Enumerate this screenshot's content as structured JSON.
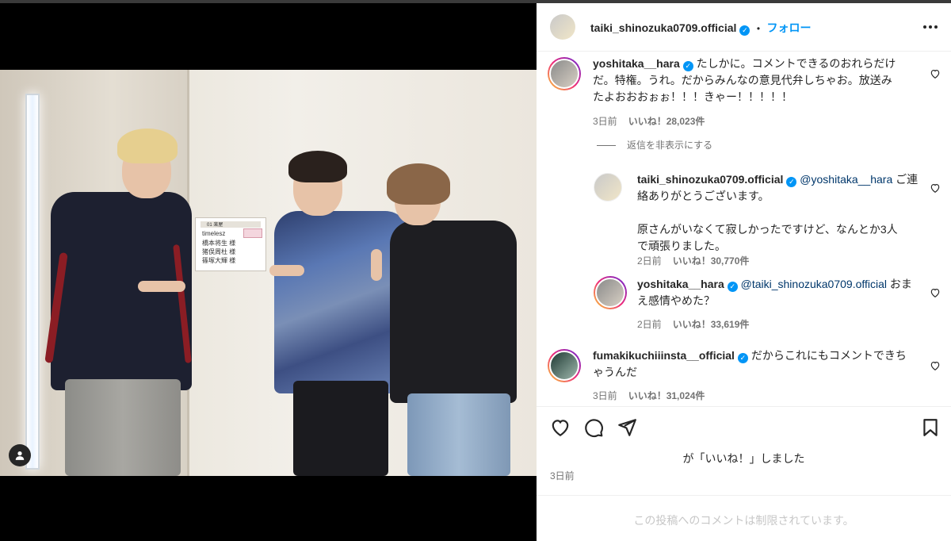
{
  "post": {
    "author": "taiki_shinozuka0709.official",
    "follow_label": "フォロー",
    "dot": "•",
    "more_icon": "more-horizontal-icon"
  },
  "photo": {
    "nameplate": {
      "header": "01 楽屋",
      "group": "timelesz",
      "names": [
        "橋本将生 様",
        "猪俣周杜 様",
        "篠塚大輝 様"
      ]
    }
  },
  "comments": [
    {
      "user": "yoshitaka__hara",
      "text_lines": [
        "たしかに。コメントできるのおれらだけ",
        "だ。特権。うれ。だからみんなの意見代弁しちゃお。放送み",
        "たよおおおぉぉ！！！きゃー！！！！！"
      ],
      "time": "3日前",
      "likes": "いいね！28,023件"
    }
  ],
  "hide_replies_label": "返信を非表示にする",
  "replies": [
    {
      "user": "taiki_shinozuka0709.official",
      "mention": "@yoshitaka__hara",
      "text_lines": [
        "ご連",
        "絡ありがとうございます。",
        "",
        "原さんがいなくて寂しかったですけど、なんとか3人",
        "で頑張りました。"
      ],
      "time": "2日前",
      "likes": "いいね！30,770件"
    },
    {
      "user": "yoshitaka__hara",
      "mention": "@taiki_shinozuka0709.official",
      "text_lines": [
        "おま",
        "え感情やめた？"
      ],
      "time": "2日前",
      "likes": "いいね！33,619件"
    }
  ],
  "comment3": {
    "user": "fumakikuchiiinsta__official",
    "text_lines": [
      "だからこれにもコメントできち",
      "ゃうんだ"
    ],
    "time": "3日前",
    "likes": "いいね！31,024件"
  },
  "liked_by": "が「いいね！」しました",
  "post_time": "3日前",
  "comments_restricted": "この投稿へのコメントは制限されています。"
}
